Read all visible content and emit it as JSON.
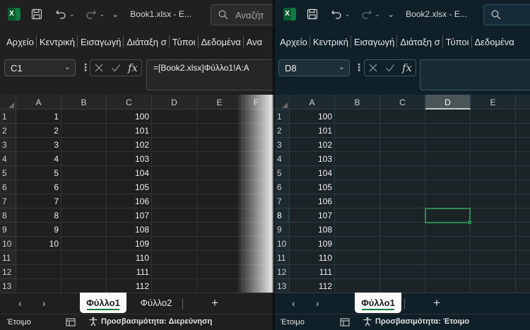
{
  "windows": [
    {
      "title": "Book1.xlsx  -  E...",
      "search_placeholder": "Αναζήτ",
      "ribbon_tabs": [
        "Αρχείο",
        "Κεντρική",
        "Εισαγωγή",
        "Διάταξη σ",
        "Τύποι",
        "Δεδομένα",
        "Ανα"
      ],
      "name_box": "C1",
      "formula": "=[Book2.xlsx]Φύλλο1!A:A",
      "columns": [
        "A",
        "B",
        "C",
        "D",
        "E",
        "F"
      ],
      "selected_column": "",
      "rows": [
        "1",
        "2",
        "3",
        "4",
        "5",
        "6",
        "7",
        "8",
        "9",
        "10",
        "11",
        "12",
        "13"
      ],
      "selected_row": "",
      "cells_A": [
        "1",
        "2",
        "3",
        "4",
        "5",
        "6",
        "7",
        "8",
        "9",
        "10",
        "",
        "",
        ""
      ],
      "cells_C": [
        "100",
        "101",
        "102",
        "103",
        "104",
        "105",
        "106",
        "107",
        "108",
        "109",
        "110",
        "111",
        "112"
      ],
      "sheets": [
        "Φύλλο1",
        "Φύλλο2"
      ],
      "active_sheet": "Φύλλο1",
      "status": "Έτοιμο",
      "accessibility": "Προσβασιμότητα: Διερεύνηση"
    },
    {
      "title": "Book2.xlsx  -  E...",
      "search_placeholder": "",
      "ribbon_tabs": [
        "Αρχείο",
        "Κεντρική",
        "Εισαγωγή",
        "Διάταξη σ",
        "Τύποι",
        "Δεδομένα"
      ],
      "name_box": "D8",
      "formula": "",
      "columns": [
        "A",
        "B",
        "C",
        "D",
        "E"
      ],
      "selected_column": "D",
      "rows": [
        "1",
        "2",
        "3",
        "4",
        "5",
        "6",
        "7",
        "8",
        "9",
        "10",
        "11",
        "12",
        "13"
      ],
      "selected_row": "8",
      "cells_A": [
        "100",
        "101",
        "102",
        "103",
        "104",
        "105",
        "106",
        "107",
        "108",
        "109",
        "110",
        "111",
        "112"
      ],
      "sheets": [
        "Φύλλο1"
      ],
      "active_sheet": "Φύλλο1",
      "status": "Έτοιμο",
      "accessibility": "Προσβασιμότητα: Έτοιμο"
    }
  ],
  "icons": {
    "excel": "excel-logo-icon",
    "save": "save-icon",
    "undo": "undo-icon",
    "redo": "redo-icon",
    "search": "search-icon",
    "cancel": "cancel-icon",
    "confirm": "checkmark-icon",
    "function": "function-icon",
    "accessibility": "accessibility-icon"
  },
  "labels": {
    "fx": "fx",
    "prev": "‹",
    "next": "›",
    "add": "+"
  },
  "colors": {
    "accent": "#107c41",
    "active_cell_border": "#2e8a55"
  }
}
